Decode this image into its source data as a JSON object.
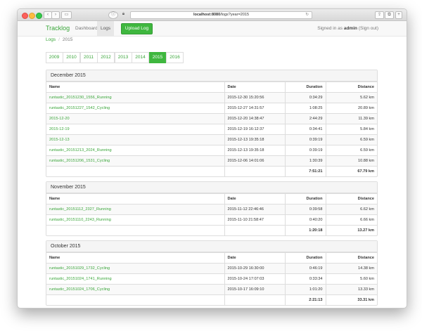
{
  "browser": {
    "url_host": "localhost:8080",
    "url_path": "/logs?year=2015",
    "reader_icon": "reader-icon",
    "lock_icon": "lock-icon"
  },
  "nav": {
    "brand": "Tracklog",
    "dashboard": "Dashboard",
    "logs": "Logs",
    "upload": "Upload Log",
    "signed_in_prefix": "Signed in as",
    "username": "admin",
    "signout": "(Sign out)"
  },
  "breadcrumb": {
    "root": "Logs",
    "sep": "/",
    "current": "2015"
  },
  "years": [
    "2009",
    "2010",
    "2011",
    "2012",
    "2013",
    "2014",
    "2015",
    "2016"
  ],
  "active_year": "2015",
  "columns": {
    "name": "Name",
    "date": "Date",
    "duration": "Duration",
    "distance": "Distance"
  },
  "months": [
    {
      "title": "December 2015",
      "rows": [
        {
          "name": "runtastic_20151230_1556_Running",
          "date": "2015-12-30 15:20:56",
          "duration": "0:34:29",
          "distance": "5.62 km"
        },
        {
          "name": "runtastic_20151227_1542_Cycling",
          "date": "2015-12-27 14:31:57",
          "duration": "1:08:25",
          "distance": "20.89 km"
        },
        {
          "name": "2015-12-20",
          "date": "2015-12-20 14:38:47",
          "duration": "2:44:29",
          "distance": "11.39 km"
        },
        {
          "name": "2015-12-19",
          "date": "2015-12-19 16:12:37",
          "duration": "0:34:41",
          "distance": "5.84 km"
        },
        {
          "name": "2015-12-13",
          "date": "2015-12-13 19:35:18",
          "duration": "0:39:19",
          "distance": "6.59 km"
        },
        {
          "name": "runtastic_20151213_2024_Running",
          "date": "2015-12-13 19:35:18",
          "duration": "0:39:19",
          "distance": "6.59 km"
        },
        {
          "name": "runtastic_20151206_1531_Cycling",
          "date": "2015-12-06 14:01:06",
          "duration": "1:30:39",
          "distance": "10.88 km"
        }
      ],
      "total_duration": "7:51:21",
      "total_distance": "67.79 km"
    },
    {
      "title": "November 2015",
      "rows": [
        {
          "name": "runtastic_20151112_2327_Running",
          "date": "2015-11-12 22:46:46",
          "duration": "0:39:58",
          "distance": "6.62 km"
        },
        {
          "name": "runtastic_20151110_2243_Running",
          "date": "2015-11-10 21:58:47",
          "duration": "0:40:20",
          "distance": "6.66 km"
        }
      ],
      "total_duration": "1:20:18",
      "total_distance": "13.27 km"
    },
    {
      "title": "October 2015",
      "rows": [
        {
          "name": "runtastic_20151029_1732_Cycling",
          "date": "2015-10-29 16:30:00",
          "duration": "0:46:19",
          "distance": "14.38 km"
        },
        {
          "name": "runtastic_20151024_1741_Running",
          "date": "2015-10-24 17:07:03",
          "duration": "0:33:34",
          "distance": "5.60 km"
        },
        {
          "name": "runtastic_20151024_1706_Cycling",
          "date": "2015-10-17 16:09:10",
          "duration": "1:01:20",
          "distance": "13.33 km"
        }
      ],
      "total_duration": "2:21:13",
      "total_distance": "33.31 km"
    }
  ]
}
